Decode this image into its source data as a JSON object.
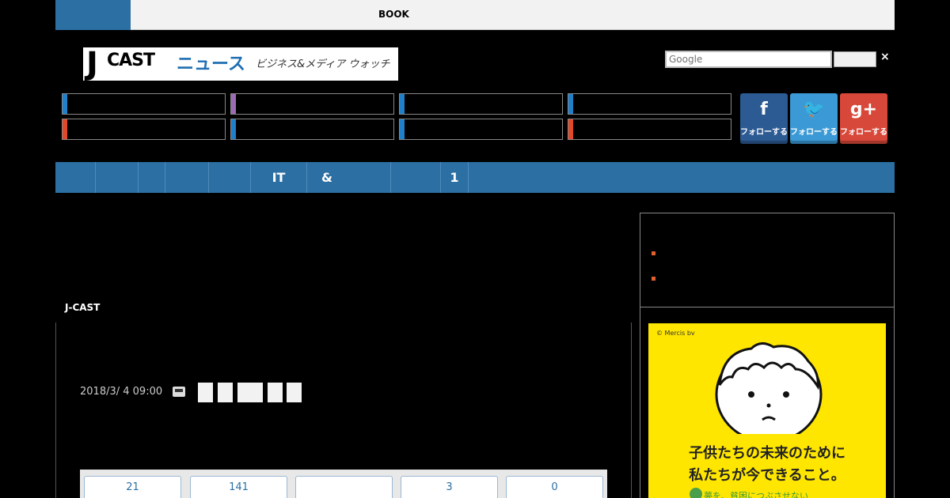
{
  "topbar": {
    "book_label": "BOOK"
  },
  "logo": {
    "j": "J",
    "cast": "CAST",
    "news": "ニュース",
    "tagline": "ビジネス&メディア ウォッチ"
  },
  "search": {
    "placeholder": "Google",
    "close": "×"
  },
  "categories": {
    "bar_colors": [
      "#1f7fc8",
      "#9b6bb5",
      "#1f7fc8",
      "#1f7fc8",
      "#e04a2a",
      "#1f7fc8",
      "#1f7fc8",
      "#e04a2a"
    ]
  },
  "social": [
    {
      "icon": "facebook-icon",
      "glyph": "f",
      "label": "フォローする",
      "color": "#2c5a92"
    },
    {
      "icon": "twitter-icon",
      "glyph": "🐦",
      "label": "フォローする",
      "color": "#3b9ad6"
    },
    {
      "icon": "googleplus-icon",
      "glyph": "g+",
      "label": "フォローする",
      "color": "#d8483a"
    }
  ],
  "nav": {
    "items": [
      "",
      "",
      "",
      "",
      "",
      "IT",
      "&",
      "",
      "1",
      ""
    ]
  },
  "article": {
    "source": "J-CAST",
    "date": "2018/3/ 4 09:00"
  },
  "stats": [
    "21",
    "141",
    "",
    "3",
    "0"
  ],
  "ad": {
    "credit": "© Mercis bv",
    "line1": "子供たちの未来のために",
    "line2": "私たちが今できること。",
    "line3": "夢を、貧困につぶさせない"
  },
  "colors": {
    "accent_blue": "#2b6fa3",
    "ad_yellow": "#ffe600"
  }
}
